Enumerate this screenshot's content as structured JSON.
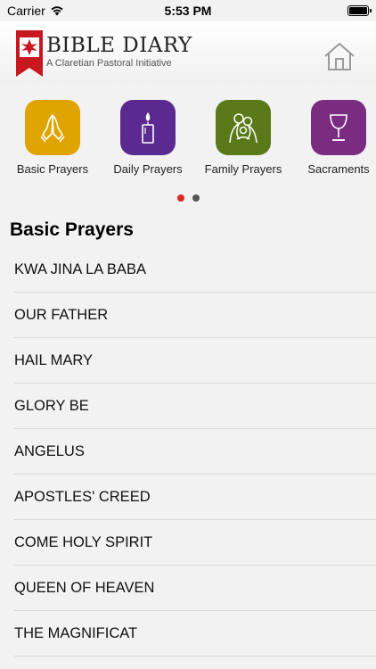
{
  "status": {
    "carrier": "Carrier",
    "time": "5:53 PM",
    "battery_level": 1.0
  },
  "header": {
    "title": "BIBLE DIARY",
    "subtitle": "A Claretian Pastoral Initiative"
  },
  "categories": [
    {
      "label": "Basic Prayers",
      "icon": "praying-hands-icon",
      "color": "#e0a400"
    },
    {
      "label": "Daily Prayers",
      "icon": "candle-icon",
      "color": "#5b2a91"
    },
    {
      "label": "Family Prayers",
      "icon": "holy-family-icon",
      "color": "#5a7a1a"
    },
    {
      "label": "Sacraments",
      "icon": "chalice-icon",
      "color": "#7a2c80"
    }
  ],
  "pager": {
    "pages": 2,
    "active": 0
  },
  "section_title": "Basic Prayers",
  "prayers": [
    "KWA JINA LA BABA",
    "OUR FATHER",
    "HAIL MARY",
    "GLORY BE",
    "ANGELUS",
    "APOSTLES' CREED",
    "COME HOLY SPIRIT",
    "QUEEN OF HEAVEN",
    "THE MAGNIFICAT"
  ]
}
